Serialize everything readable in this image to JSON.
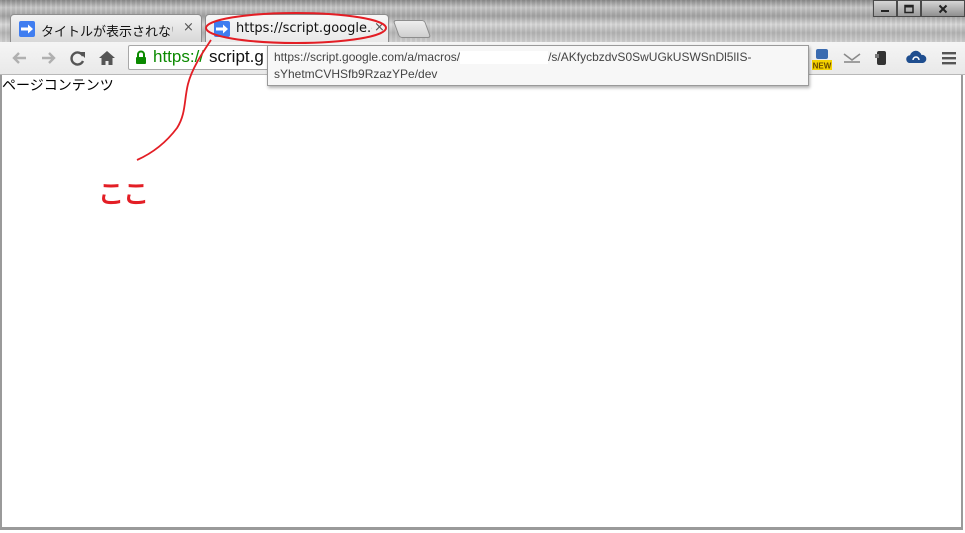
{
  "browser": {
    "tabs": [
      {
        "title": "タイトルが表示されない",
        "close": "×",
        "active": false
      },
      {
        "title": "https://script.google.co",
        "close": "×",
        "active": true
      }
    ],
    "window_controls": [
      "minimize",
      "maximize",
      "close"
    ]
  },
  "toolbar": {
    "url_scheme": "https://",
    "url_rest": "script.g",
    "icons": [
      "back-icon",
      "forward-icon",
      "reload-icon",
      "home-icon",
      "lock-icon",
      "extension-new-icon",
      "mail-icon",
      "evernote-icon",
      "cloud-icon",
      "menu-icon"
    ],
    "badge_text": "NEW"
  },
  "tooltip": {
    "line1_prefix": "https://script.google.com/a/macros/",
    "line1_suffix": "/s/AKfycbzdvS0SwUGkUSWSnDl5lIS-",
    "line2": "sYhetmCVHSfb9RzazYPe/dev"
  },
  "page": {
    "content_text": "ページコンテンツ"
  },
  "annotation": {
    "text": "ここ",
    "color": "#e31e25"
  },
  "colors": {
    "tab_icon": "#3f7df0",
    "secure_scheme": "#0b8a00"
  }
}
